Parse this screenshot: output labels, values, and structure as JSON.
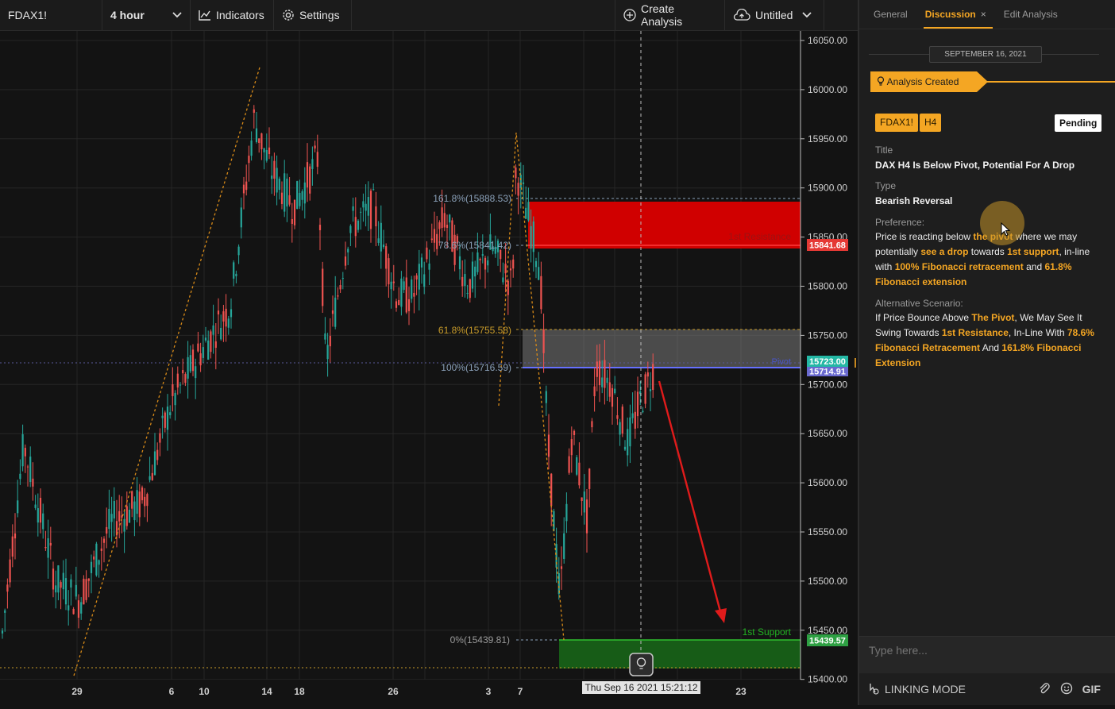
{
  "toolbar": {
    "symbol": "FDAX1!",
    "interval": "4 hour",
    "indicators_label": "Indicators",
    "settings_label": "Settings",
    "create_analysis_label": "Create Analysis",
    "layout_name": "Untitled"
  },
  "chart": {
    "price_axis": [
      "16050.00",
      "16000.00",
      "15950.00",
      "15900.00",
      "15850.00",
      "15800.00",
      "15750.00",
      "15700.00",
      "15650.00",
      "15600.00",
      "15550.00",
      "15500.00",
      "15450.00",
      "15400.00"
    ],
    "time_axis": [
      "29",
      "6",
      "10",
      "14",
      "18",
      "26",
      "3",
      "7",
      "23"
    ],
    "crosshair_time": "Thu Sep 16 2021 15:21:12",
    "fib_labels": {
      "f1618": "161.8%(15888.53)",
      "f786": "78.6%(15841.42)",
      "f618": "61.8%(15755.58)",
      "f100": "100%(15716.59)",
      "f0": "0%(15439.81)"
    },
    "zone_labels": {
      "resistance": "1st Resistance",
      "support": "1st Support",
      "pivot": "Pivot"
    },
    "price_tags": {
      "resistance": "15841.68",
      "pivot_top": "15723.00",
      "pivot_bottom": "15714.91",
      "support": "15439.57"
    },
    "colors": {
      "up": "#26a69a",
      "down": "#ef5350",
      "resistance": "#e00000",
      "support": "#1f6f1f",
      "fib": "#f4a623"
    }
  },
  "panel": {
    "tabs": [
      "General",
      "Discussion",
      "Edit Analysis"
    ],
    "date": "SEPTEMBER 16, 2021",
    "created_label": "Analysis Created",
    "tags": [
      "FDAX1!",
      "H4"
    ],
    "status": "Pending",
    "title_label": "Title",
    "title_value": "DAX H4 Is Below Pivot, Potential For A Drop",
    "type_label": "Type",
    "type_value": "Bearish Reversal",
    "preference_label": "Preference:",
    "preference_parts": {
      "p1": "Price is reacting below ",
      "h1": "the pivot",
      "p2": " where we may potentially ",
      "h2": "see a drop",
      "p3": " towards ",
      "h3": "1st support",
      "p4": ", in-line with ",
      "h4": "100% Fibonacci retracement",
      "p5": " and ",
      "h5": "61.8% Fibonacci extension"
    },
    "alternative_label": "Alternative Scenario:",
    "alternative_parts": {
      "p1": "If Price Bounce Above ",
      "h1": "The Pivot",
      "p2": ", We May See It Swing Towards ",
      "h2": "1st Resistance",
      "p3": ", In-Line With ",
      "h3": "78.6% Fibonacci Retracement",
      "p4": " And ",
      "h4": "161.8% Fibonacci Extension"
    },
    "reply_placeholder": "Type here...",
    "linking_mode": "LINKING MODE",
    "gif_label": "GIF"
  }
}
